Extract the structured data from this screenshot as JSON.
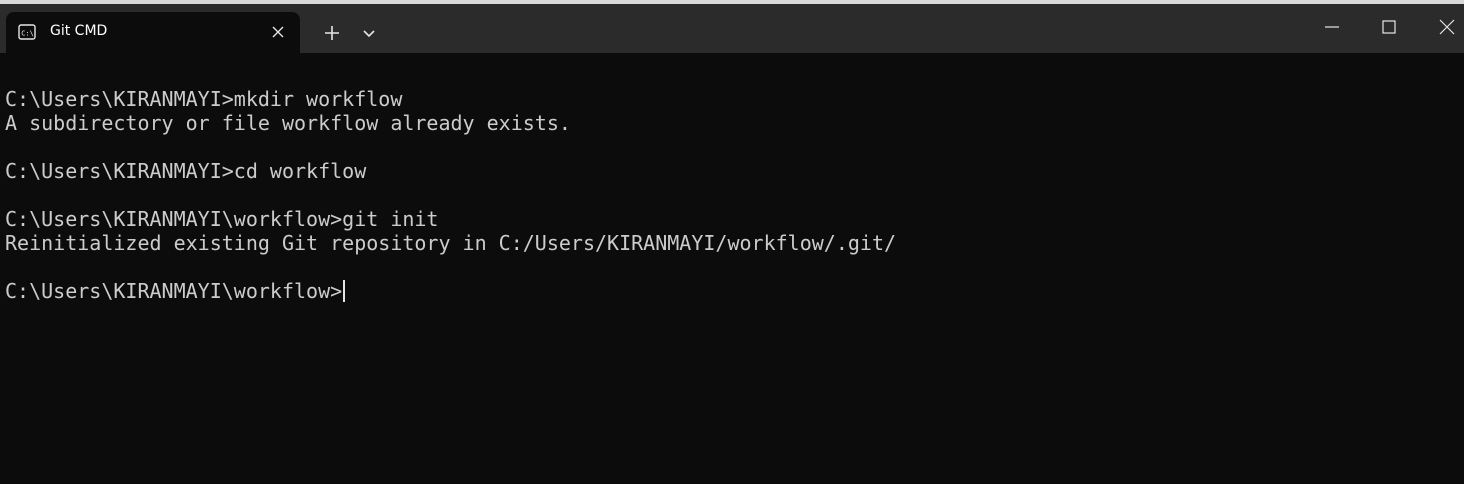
{
  "window": {
    "tab_title": "Git CMD",
    "icons": {
      "tab": "terminal-icon",
      "close_tab": "close-icon",
      "new_tab": "plus-icon",
      "dropdown": "chevron-down-icon",
      "minimize": "minimize-icon",
      "maximize": "maximize-icon",
      "close": "close-icon"
    }
  },
  "terminal": {
    "lines": [
      "C:\\Users\\KIRANMAYI>mkdir workflow",
      "A subdirectory or file workflow already exists.",
      "C:\\Users\\KIRANMAYI>cd workflow",
      "C:\\Users\\KIRANMAYI\\workflow>git init",
      "Reinitialized existing Git repository in C:/Users/KIRANMAYI/workflow/.git/",
      "C:\\Users\\KIRANMAYI\\workflow>"
    ]
  },
  "colors": {
    "titlebar": "#2b2b2b",
    "terminal_bg": "#0c0c0c",
    "text": "#cccccc"
  }
}
